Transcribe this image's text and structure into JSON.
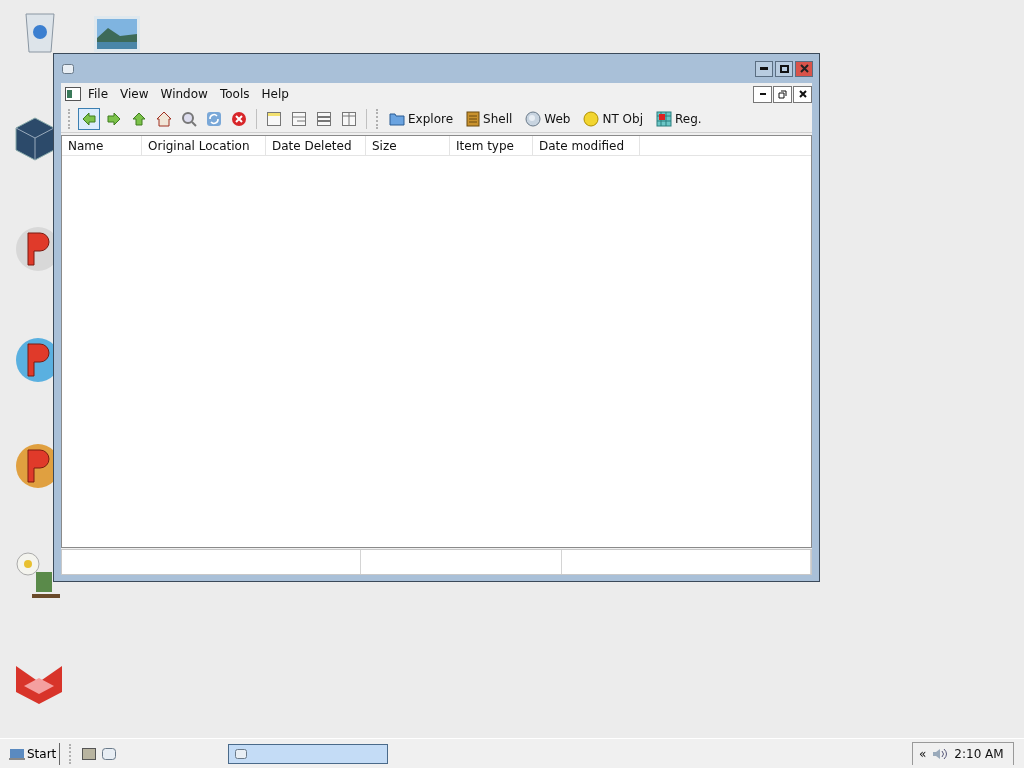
{
  "window": {
    "menu": [
      "File",
      "View",
      "Window",
      "Tools",
      "Help"
    ],
    "toolbar_buttons": [
      {
        "label": "Explore",
        "kind": "folder"
      },
      {
        "label": "Shell",
        "kind": "shell"
      },
      {
        "label": "Web",
        "kind": "globe"
      },
      {
        "label": "NT Obj",
        "kind": "object"
      },
      {
        "label": "Reg.",
        "kind": "registry"
      }
    ],
    "columns": [
      "Name",
      "Original Location",
      "Date Deleted",
      "Size",
      "Item type",
      "Date modified"
    ]
  },
  "taskbar": {
    "start": "Start",
    "tasks": [
      {
        "selected": true
      }
    ],
    "tray_toggle": "«",
    "clock": "2:10 AM"
  }
}
